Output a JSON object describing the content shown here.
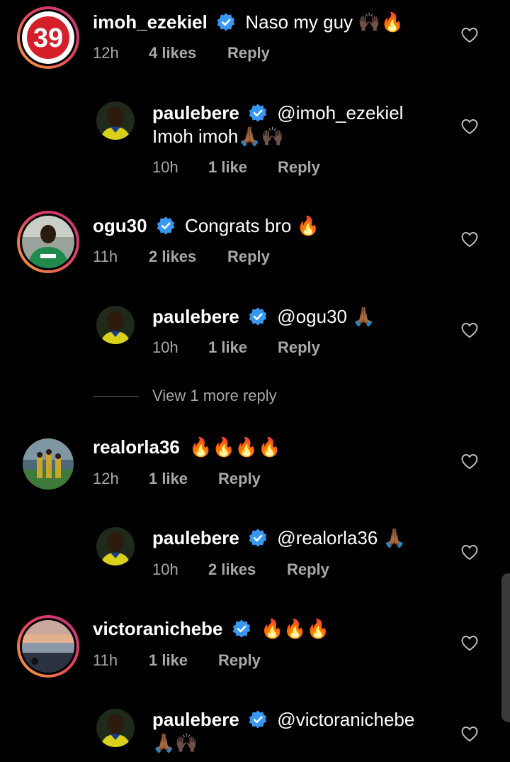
{
  "threads": [
    {
      "username": "imoh_ezekiel",
      "text": "Naso my guy 🙌🏿🔥",
      "time": "12h",
      "likes": "4 likes",
      "reply": "Reply"
    },
    {
      "username": "paulebere",
      "text": "@imoh_ezekiel",
      "text2": "Imoh imoh🙏🏾🙌🏿",
      "time": "10h",
      "likes": "1 like",
      "reply": "Reply"
    },
    {
      "username": "ogu30",
      "text": "Congrats bro 🔥",
      "time": "11h",
      "likes": "2 likes",
      "reply": "Reply"
    },
    {
      "username": "paulebere",
      "text": "@ogu30 🙏🏾",
      "time": "10h",
      "likes": "1 like",
      "reply": "Reply"
    },
    {
      "username": "realorla36",
      "text": "🔥🔥🔥🔥",
      "time": "12h",
      "likes": "1 like",
      "reply": "Reply"
    },
    {
      "username": "paulebere",
      "text": "@realorla36 🙏🏾",
      "time": "10h",
      "likes": "2 likes",
      "reply": "Reply"
    },
    {
      "username": "victoranichebe",
      "text": "🔥🔥🔥",
      "time": "11h",
      "likes": "1 like",
      "reply": "Reply"
    },
    {
      "username": "paulebere",
      "text": "@victoranichebe",
      "text2": "🙏🏾🙌🏿"
    }
  ],
  "view_more": "View 1 more reply",
  "avatar_badge": "39",
  "colors": {
    "background": "#000000",
    "meta_text": "#a8a8a8",
    "verified_blue": "#3897f0",
    "story_ring": "#e4405f"
  }
}
